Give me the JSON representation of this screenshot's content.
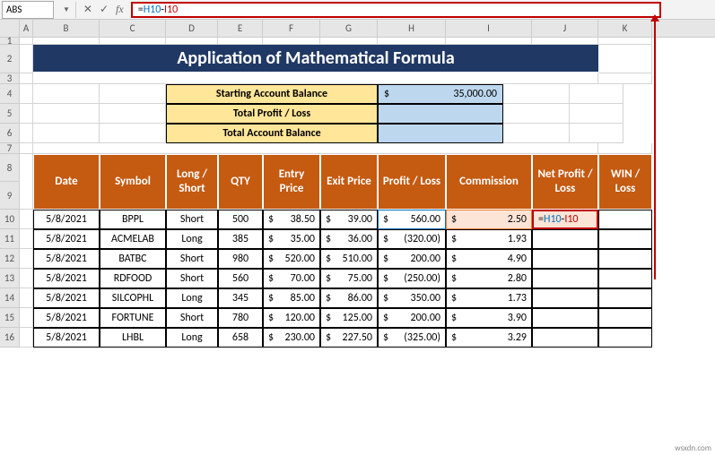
{
  "nameBox": "ABS",
  "formulaBar": "=H10-I10",
  "columns": [
    "A",
    "B",
    "C",
    "D",
    "E",
    "F",
    "G",
    "H",
    "I",
    "J",
    "K"
  ],
  "rowNumbers": [
    1,
    2,
    3,
    4,
    5,
    6,
    7,
    8,
    9,
    10,
    11,
    12,
    13,
    14,
    15,
    16
  ],
  "title": "Application of Mathematical Formula",
  "summary": {
    "startingLabel": "Starting Account Balance",
    "startingValueSym": "$",
    "startingValue": "35,000.00",
    "profitLabel": "Total Profit / Loss",
    "balanceLabel": "Total Account Balance"
  },
  "headers": {
    "date": "Date",
    "symbol": "Symbol",
    "longShort": "Long / Short",
    "qty": "QTY",
    "entry": "Entry Price",
    "exit": "Exit Price",
    "pl": "Profit / Loss",
    "commission": "Commission",
    "netpl": "Net Profit / Loss",
    "winloss": "WIN / Loss"
  },
  "activeCellFormula": {
    "eq": "=",
    "ref1": "H10",
    "op": "-",
    "ref2": "I10"
  },
  "table": [
    {
      "date": "5/8/2021",
      "symbol": "BPPL",
      "ls": "Short",
      "qty": "500",
      "entry": "38.50",
      "exit": "39.00",
      "pl": "560.00",
      "plNeg": false,
      "comm": "2.50"
    },
    {
      "date": "5/8/2021",
      "symbol": "ACMELAB",
      "ls": "Long",
      "qty": "385",
      "entry": "35.00",
      "exit": "36.00",
      "pl": "(320.00)",
      "plNeg": true,
      "comm": "1.93"
    },
    {
      "date": "5/8/2021",
      "symbol": "BATBC",
      "ls": "Short",
      "qty": "980",
      "entry": "520.00",
      "exit": "510.00",
      "pl": "200.00",
      "plNeg": false,
      "comm": "4.90"
    },
    {
      "date": "5/8/2021",
      "symbol": "RDFOOD",
      "ls": "Short",
      "qty": "560",
      "entry": "70.00",
      "exit": "75.00",
      "pl": "(250.00)",
      "plNeg": true,
      "comm": "2.80"
    },
    {
      "date": "5/8/2021",
      "symbol": "SILCOPHL",
      "ls": "Long",
      "qty": "345",
      "entry": "85.00",
      "exit": "86.00",
      "pl": "350.00",
      "plNeg": false,
      "comm": "1.73"
    },
    {
      "date": "5/8/2021",
      "symbol": "FORTUNE",
      "ls": "Short",
      "qty": "780",
      "entry": "120.00",
      "exit": "125.00",
      "pl": "200.00",
      "plNeg": false,
      "comm": "3.90"
    },
    {
      "date": "5/8/2021",
      "symbol": "LHBL",
      "ls": "Long",
      "qty": "658",
      "entry": "230.00",
      "exit": "227.50",
      "pl": "(325.00)",
      "plNeg": true,
      "comm": "3.29"
    }
  ],
  "watermark": "wsxdn.com"
}
